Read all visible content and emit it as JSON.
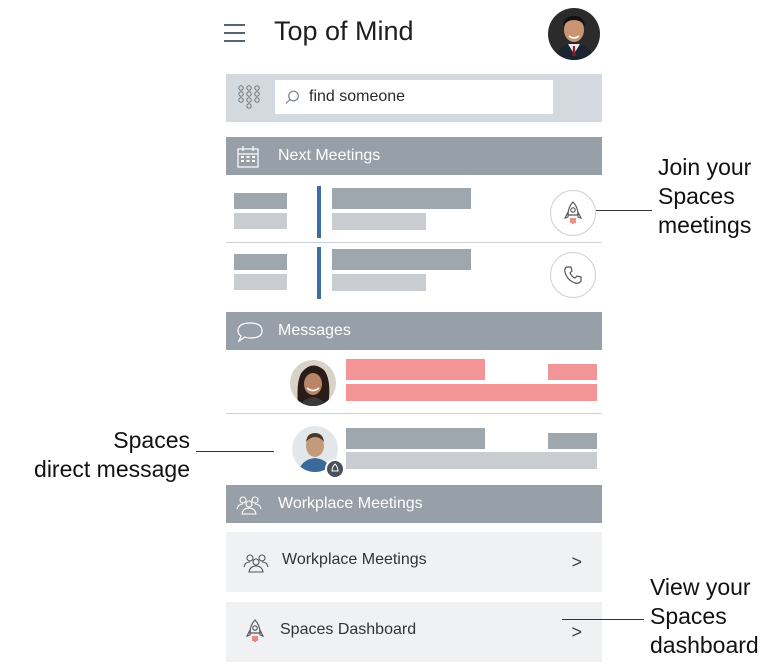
{
  "header": {
    "title": "Top of Mind"
  },
  "search": {
    "placeholder": "find someone"
  },
  "sections": {
    "next_meetings": "Next Meetings",
    "messages": "Messages",
    "workplace_meetings": "Workplace Meetings"
  },
  "nav_rows": [
    {
      "label": "Workplace Meetings",
      "chevron": ">"
    },
    {
      "label": "Spaces Dashboard",
      "chevron": ">"
    }
  ],
  "callouts": {
    "join": [
      "Join your",
      "Spaces",
      "meetings"
    ],
    "direct": [
      "Spaces",
      "direct message"
    ],
    "dashboard": [
      "View your",
      "Spaces",
      "dashboard"
    ]
  },
  "colors": {
    "section_bg": "#979fa8",
    "accent_bar": "#3a6ea5",
    "unread_pink": "#f39596",
    "placeholder_dark": "#9ea6ae",
    "placeholder_light": "#c9cdd2"
  },
  "icons": [
    "hamburger-menu-icon",
    "dialpad-icon",
    "search-icon",
    "calendar-icon",
    "rocket-icon",
    "phone-icon",
    "speech-bubble-icon",
    "people-group-icon",
    "chevron-right-icon"
  ]
}
